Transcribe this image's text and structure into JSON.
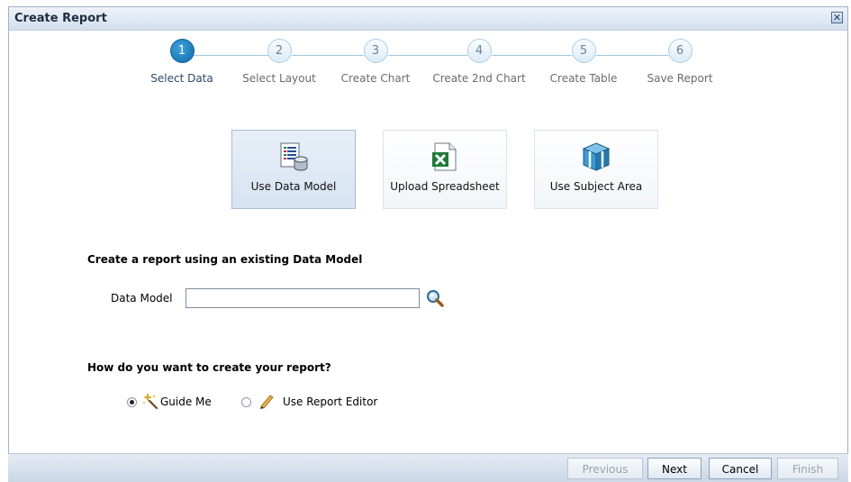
{
  "dialog": {
    "title": "Create Report",
    "close_symbol": "✕"
  },
  "train": {
    "steps": [
      {
        "number": "1",
        "label": "Select Data",
        "active": true
      },
      {
        "number": "2",
        "label": "Select Layout",
        "active": false
      },
      {
        "number": "3",
        "label": "Create Chart",
        "active": false
      },
      {
        "number": "4",
        "label": "Create 2nd Chart",
        "active": false
      },
      {
        "number": "5",
        "label": "Create Table",
        "active": false
      },
      {
        "number": "6",
        "label": "Save Report",
        "active": false
      }
    ]
  },
  "sources": [
    {
      "label": "Use Data Model",
      "icon": "data-model-icon",
      "selected": true
    },
    {
      "label": "Upload Spreadsheet",
      "icon": "excel-spreadsheet-icon",
      "selected": false
    },
    {
      "label": "Use Subject Area",
      "icon": "subject-area-cube-icon",
      "selected": false
    }
  ],
  "data_model_section": {
    "heading": "Create a report using an existing Data Model",
    "field_label": "Data Model",
    "field_value": "",
    "search_icon": "magnifier-search-icon"
  },
  "create_mode": {
    "heading": "How do you want to create your report?",
    "options": [
      {
        "label": "Guide Me",
        "icon": "magic-wand-icon",
        "checked": true
      },
      {
        "label": "Use Report Editor",
        "icon": "pencil-icon",
        "checked": false
      }
    ]
  },
  "footer": {
    "previous_label": "Previous",
    "next_label": "Next",
    "cancel_label": "Cancel",
    "finish_label": "Finish"
  },
  "colors": {
    "active_step": "#0b6aa8",
    "selected_card": "#d6e3f1"
  }
}
